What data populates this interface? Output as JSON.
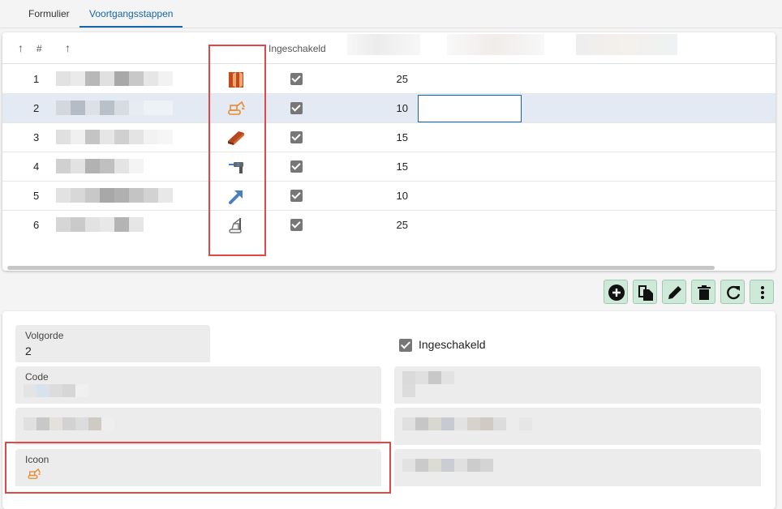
{
  "tabs": [
    {
      "label": "Formulier"
    },
    {
      "label": "Voortgangsstappen"
    }
  ],
  "grid": {
    "header": {
      "sort_icon": "arrow-up-icon",
      "num_label": "#",
      "enabled_label": "Ingeschakeld"
    },
    "rows": [
      {
        "num": "1",
        "icon": "door-icon",
        "enabled": true,
        "value": "25"
      },
      {
        "num": "2",
        "icon": "excavator-icon",
        "enabled": true,
        "value": "10"
      },
      {
        "num": "3",
        "icon": "steel-beam-icon",
        "enabled": true,
        "value": "15"
      },
      {
        "num": "4",
        "icon": "drill-icon",
        "enabled": true,
        "value": "15"
      },
      {
        "num": "5",
        "icon": "arrow-up-right-icon",
        "enabled": true,
        "value": "10"
      },
      {
        "num": "6",
        "icon": "pile-driver-icon",
        "enabled": true,
        "value": "25"
      }
    ],
    "selected_row": 2
  },
  "toolbar": {
    "buttons": [
      "add-icon",
      "copy-icon",
      "edit-icon",
      "delete-icon",
      "refresh-icon",
      "more-icon"
    ]
  },
  "form": {
    "volgorde_label": "Volgorde",
    "volgorde_value": "2",
    "enabled_label": "Ingeschakeld",
    "code_label": "Code",
    "icoon_label": "Icoon",
    "icoon_value": "excavator-icon"
  },
  "colors": {
    "accent": "#1565a8",
    "highlight": "#e04848",
    "toolbar_bg": "#cfe9d8"
  }
}
